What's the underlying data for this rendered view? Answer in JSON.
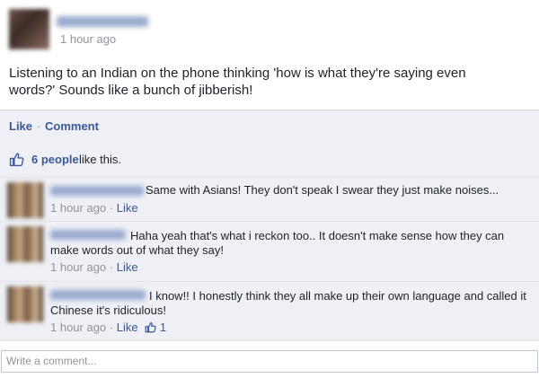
{
  "post": {
    "time": "1 hour ago",
    "text": "Listening to an Indian on the phone thinking 'how is what they're saying even words?' Sounds like a bunch of jibberish!"
  },
  "actions": {
    "like_label": "Like",
    "separator": "·",
    "comment_label": "Comment"
  },
  "likes": {
    "icon": "thumbs-up-icon",
    "count_text": "6 people",
    "suffix": "like this."
  },
  "comments": [
    {
      "text": "Same with Asians! They don't speak I swear they just make noises...",
      "time": "1 hour ago",
      "like_label": "Like"
    },
    {
      "text": "Haha yeah that's what i reckon too.. It doesn't make sense how they can make words out of what they say!",
      "time": "1 hour ago",
      "like_label": "Like"
    },
    {
      "text": "I know!! I honestly think they all make up their own language and called it Chinese it's ridiculous!",
      "time": "1 hour ago",
      "like_label": "Like",
      "like_count": "1"
    }
  ],
  "composer": {
    "placeholder": "Write a comment..."
  },
  "colors": {
    "link": "#3b5998",
    "muted": "#90949c",
    "panel": "#eef0f5"
  }
}
